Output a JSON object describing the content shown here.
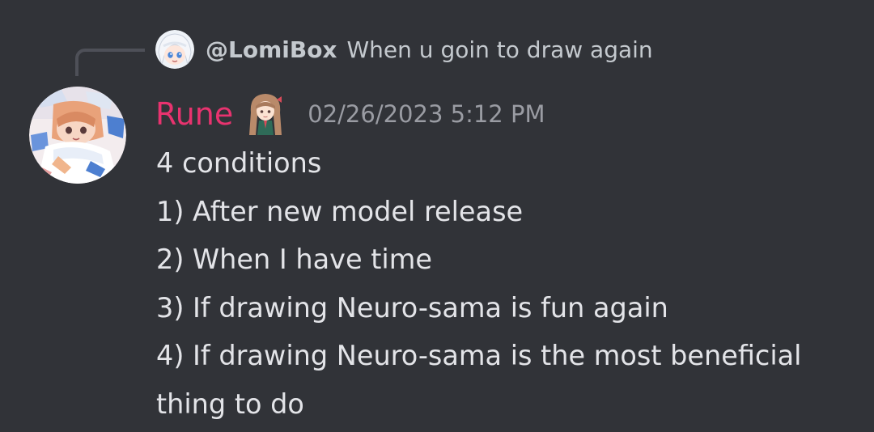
{
  "reply": {
    "author": "@LomiBox",
    "content": "When u goin to draw again"
  },
  "message": {
    "username": "Rune",
    "timestamp": "02/26/2023 5:12 PM",
    "lines": [
      "4 conditions",
      "1) After new model release",
      "2) When I have time",
      "3) If drawing Neuro-sama is fun again",
      "4) If drawing Neuro-sama is the most beneficial",
      "thing to do"
    ]
  },
  "colors": {
    "background": "#313338",
    "username": "#e8336f",
    "text": "#e3e4e8",
    "muted": "#9a9ca3"
  },
  "icons": {
    "reply_avatar": "lomibox-avatar-icon",
    "main_avatar": "rune-avatar-icon",
    "role_icon": "anime-girl-role-icon"
  }
}
